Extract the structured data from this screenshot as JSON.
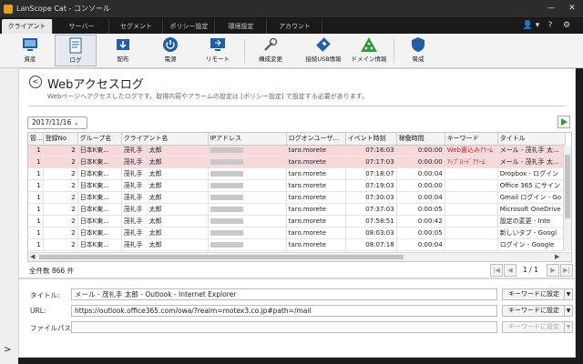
{
  "window": {
    "title": "LanScope Cat - コンソール",
    "minimize": "—",
    "close": "✕"
  },
  "modules": [
    "クライアント",
    "サーバー",
    "セグメント",
    "ポリシー設定",
    "環境設定",
    "アカウント"
  ],
  "modbar_icons": {
    "user": "👤 ▾",
    "help": "?",
    "settings": "⚙"
  },
  "toolbar": [
    {
      "label": "資産",
      "icon": "asset-icon"
    },
    {
      "label": "ログ",
      "icon": "log-icon"
    },
    {
      "label": "配布",
      "icon": "distribute-icon"
    },
    {
      "label": "電源",
      "icon": "power-icon"
    },
    {
      "label": "リモート",
      "icon": "remote-icon"
    },
    {
      "label": "構成変更",
      "icon": "config-icon"
    },
    {
      "label": "接続USB情報",
      "icon": "usb-icon"
    },
    {
      "label": "ドメイン情報",
      "icon": "domain-icon"
    },
    {
      "label": "脅威",
      "icon": "threat-icon"
    }
  ],
  "page": {
    "title": "Webアクセスログ",
    "subtitle": "Webページへアクセスしたログです。取得内容やアラームの設定は [ポリシー設定] で設定する必要があります。",
    "date": "2017/11/16"
  },
  "columns": [
    "管...",
    "登録No",
    "グループ名",
    "クライアント名",
    "IPアドレス",
    "ログオンユーザ...",
    "イベント時刻",
    "稼働時間",
    "キーワード",
    "タイトル"
  ],
  "rows": [
    {
      "alarm": true,
      "c0": "1",
      "no": "2",
      "group": "日本K東...",
      "client": "茂礼手　太郎",
      "user": "taro.morete",
      "time": "07:16:03",
      "dur": "0:00:00",
      "kw": "Web書込みｱﾗｰﾑ",
      "title": "メール - 茂礼手 太..."
    },
    {
      "alarm": true,
      "c0": "1",
      "no": "2",
      "group": "日本K東...",
      "client": "茂礼手　太郎",
      "user": "taro.morete",
      "time": "07:17:03",
      "dur": "0:00:00",
      "kw": "ｱｯﾌﾟﾛｰﾄﾞｱﾗｰﾑ",
      "title": "メール - 茂礼手 太..."
    },
    {
      "alarm": false,
      "c0": "1",
      "no": "2",
      "group": "日本K東...",
      "client": "茂礼手　太郎",
      "user": "taro.morete",
      "time": "07:18:07",
      "dur": "0:00:04",
      "kw": "",
      "title": "Dropbox - ログイン"
    },
    {
      "alarm": false,
      "c0": "1",
      "no": "2",
      "group": "日本K東...",
      "client": "茂礼手　太郎",
      "user": "taro.morete",
      "time": "07:19:03",
      "dur": "0:00:00",
      "kw": "",
      "title": "Office 365 にサイン"
    },
    {
      "alarm": false,
      "c0": "1",
      "no": "2",
      "group": "日本K東...",
      "client": "茂礼手　太郎",
      "user": "taro.morete",
      "time": "07:30:03",
      "dur": "0:00:04",
      "kw": "",
      "title": "Gmail ログイン - Go"
    },
    {
      "alarm": false,
      "c0": "1",
      "no": "2",
      "group": "日本K東...",
      "client": "茂礼手　太郎",
      "user": "taro.morete",
      "time": "07:37:03",
      "dur": "0:00:05",
      "kw": "",
      "title": "Microsoft OneDrive"
    },
    {
      "alarm": false,
      "c0": "1",
      "no": "2",
      "group": "日本K東...",
      "client": "茂礼手　太郎",
      "user": "taro.morete",
      "time": "07:58:51",
      "dur": "0:00:42",
      "kw": "",
      "title": "設定の変更 - Inte"
    },
    {
      "alarm": false,
      "c0": "1",
      "no": "2",
      "group": "日本K東...",
      "client": "茂礼手　太郎",
      "user": "taro.morete",
      "time": "08:03:03",
      "dur": "0:00:05",
      "kw": "",
      "title": "新しいタブ - Googl"
    },
    {
      "alarm": false,
      "c0": "1",
      "no": "2",
      "group": "日本K東...",
      "client": "茂礼手　太郎",
      "user": "taro.morete",
      "time": "08:07:18",
      "dur": "0:00:04",
      "kw": "",
      "title": "ログイン - Google"
    }
  ],
  "footer": {
    "total": "全件数 866 件",
    "page": "1 / 1"
  },
  "detail": {
    "title_label": "タイトル:",
    "title_value": "メール - 茂礼手 太郎 - Outlook - Internet Explorer",
    "url_label": "URL:",
    "url_value": "https://outlook.office365.com/owa/?realm=motex3.co.jp#path=/mail",
    "path_label": "ファイルパス:",
    "path_value": "",
    "kw_button": "キーワードに設定"
  }
}
